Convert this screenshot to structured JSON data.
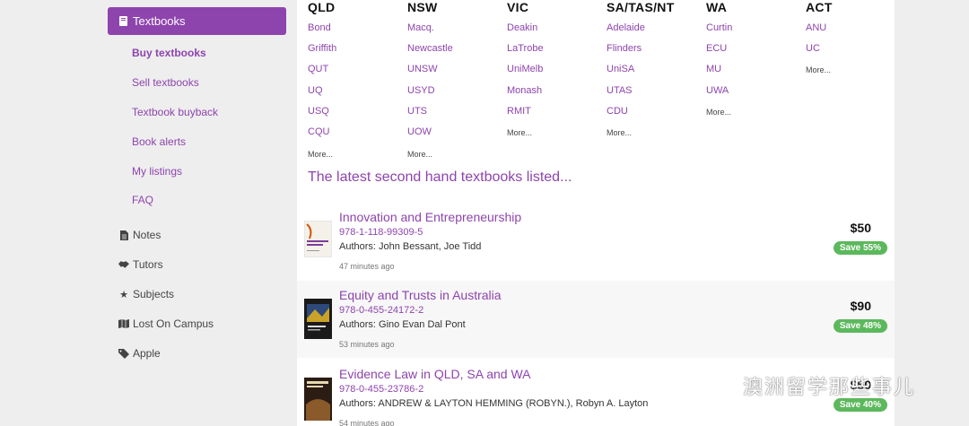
{
  "sidebar": {
    "active": {
      "label": "Textbooks",
      "icon": "book-icon"
    },
    "sub_items": [
      {
        "label": "Buy textbooks",
        "bold": true
      },
      {
        "label": "Sell textbooks"
      },
      {
        "label": "Textbook buyback"
      },
      {
        "label": "Book alerts"
      },
      {
        "label": "My listings"
      },
      {
        "label": "FAQ"
      }
    ],
    "nav_items": [
      {
        "label": "Notes",
        "icon": "file-icon"
      },
      {
        "label": "Tutors",
        "icon": "handshake-icon"
      },
      {
        "label": "Subjects",
        "icon": "star-icon"
      },
      {
        "label": "Lost On Campus",
        "icon": "map-icon"
      },
      {
        "label": "Apple",
        "icon": "tag-icon"
      }
    ]
  },
  "states": [
    {
      "name": "QLD",
      "unis": [
        "Bond",
        "Griffith",
        "QUT",
        "UQ",
        "USQ",
        "CQU"
      ],
      "more": "More..."
    },
    {
      "name": "NSW",
      "unis": [
        "Macq.",
        "Newcastle",
        "UNSW",
        "USYD",
        "UTS",
        "UOW"
      ],
      "more": "More..."
    },
    {
      "name": "VIC",
      "unis": [
        "Deakin",
        "LaTrobe",
        "UniMelb",
        "Monash",
        "RMIT"
      ],
      "more": "More..."
    },
    {
      "name": "SA/TAS/NT",
      "unis": [
        "Adelaide",
        "Flinders",
        "UniSA",
        "UTAS",
        "CDU"
      ],
      "more": "More..."
    },
    {
      "name": "WA",
      "unis": [
        "Curtin",
        "ECU",
        "MU",
        "UWA"
      ],
      "more": "More..."
    },
    {
      "name": "ACT",
      "unis": [
        "ANU",
        "UC"
      ],
      "more": "More..."
    }
  ],
  "latest": {
    "title": "The latest second hand textbooks listed...",
    "books": [
      {
        "title": "Innovation and Entrepreneurship",
        "isbn": "978-1-118-99309-5",
        "authors": "Authors: John Bessant, Joe Tidd",
        "time": "47 minutes ago",
        "price": "$50",
        "save": "Save 55%"
      },
      {
        "title": "Equity and Trusts in Australia",
        "isbn": "978-0-455-24172-2",
        "authors": "Authors: Gino Evan Dal Pont",
        "time": "53 minutes ago",
        "price": "$90",
        "save": "Save 48%"
      },
      {
        "title": "Evidence Law in QLD, SA and WA",
        "isbn": "978-0-455-23786-2",
        "authors": "Authors: ANDREW & LAYTON HEMMING (ROBYN.), Robyn A. Layton",
        "time": "54 minutes ago",
        "price": "$50",
        "save": "Save 40%"
      }
    ]
  },
  "watermark": {
    "text": "澳洲留学那些事儿",
    "icon": "wechat-icon"
  },
  "colors": {
    "accent": "#8e44ad",
    "save_badge": "#5cb85c",
    "sidebar_bg": "#eeeeee"
  }
}
